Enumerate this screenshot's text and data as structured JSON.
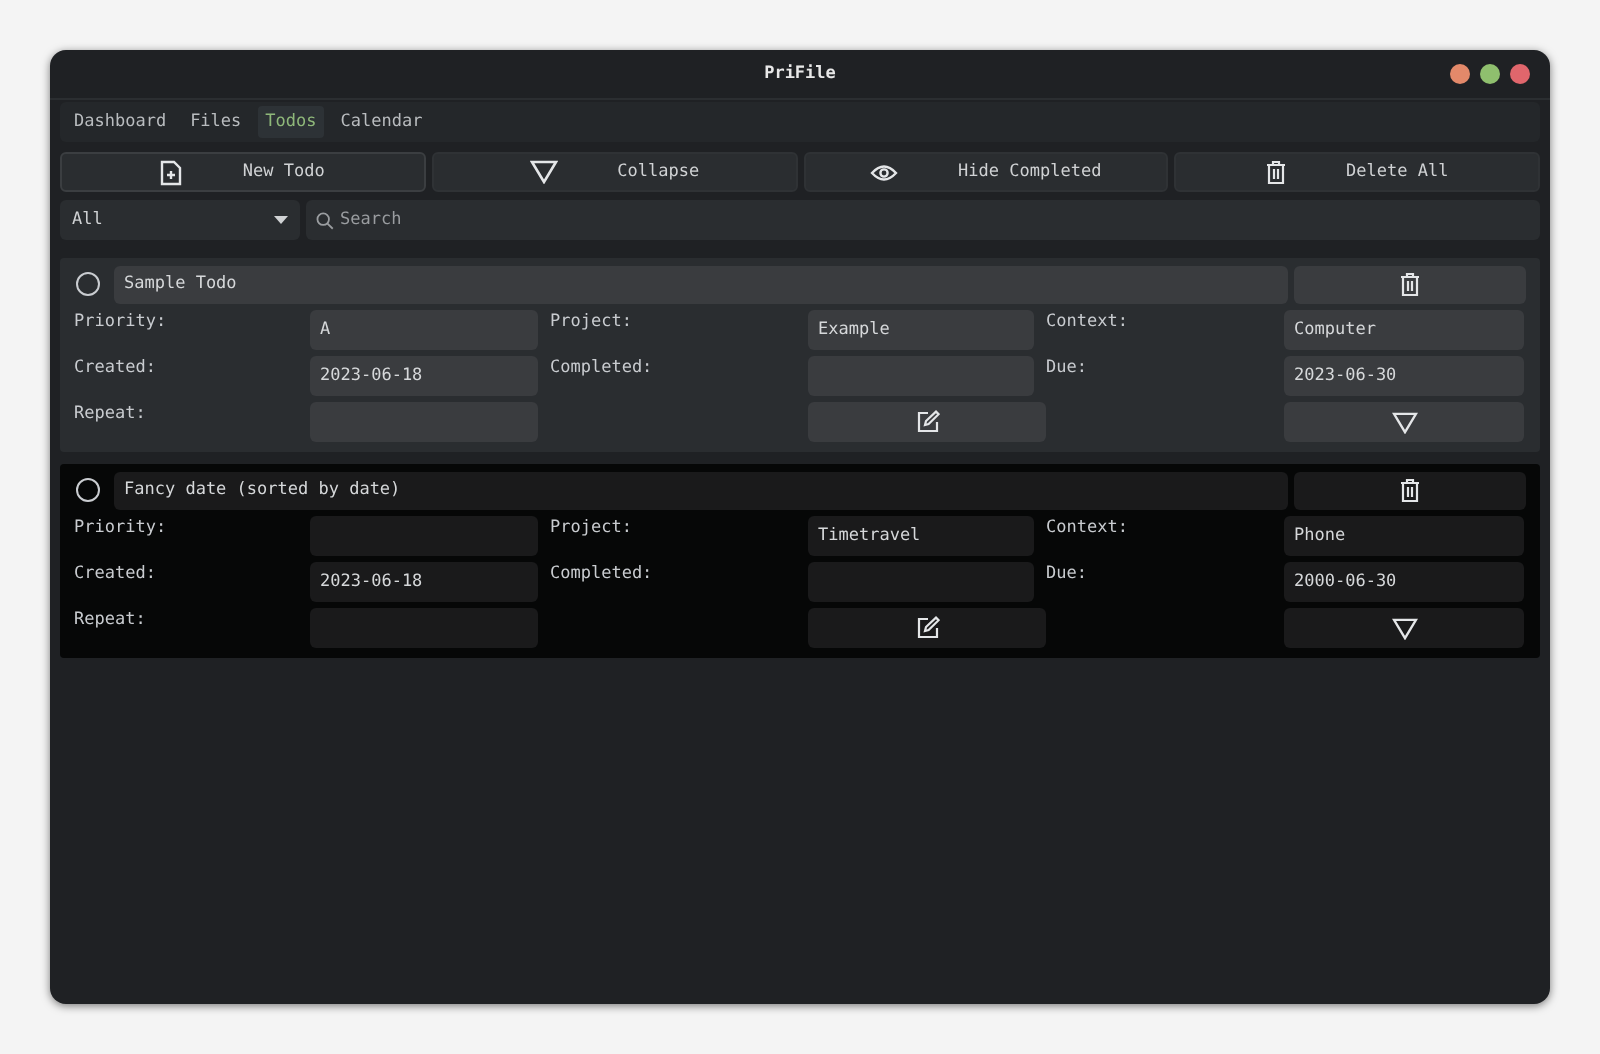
{
  "window": {
    "title": "PriFile"
  },
  "tabs": [
    {
      "label": "Dashboard",
      "selected": false
    },
    {
      "label": "Files",
      "selected": false
    },
    {
      "label": "Todos",
      "selected": true
    },
    {
      "label": "Calendar",
      "selected": false
    }
  ],
  "toolbar": [
    {
      "label": "New Todo",
      "kind": "new"
    },
    {
      "label": "Collapse",
      "kind": "collapse"
    },
    {
      "label": "Hide Completed",
      "kind": "hide"
    },
    {
      "label": "Delete All",
      "kind": "delete"
    }
  ],
  "filter": {
    "value": "All"
  },
  "search": {
    "placeholder": "Search"
  },
  "todos": [
    {
      "title": "Sample Todo",
      "checked": false,
      "selected": false,
      "rows": [
        [
          {
            "kind": "label",
            "text": "Priority:"
          },
          {
            "kind": "field",
            "value": "A"
          },
          {
            "kind": "label",
            "text": "Project:"
          },
          {
            "kind": "field",
            "value": "Example"
          },
          {
            "kind": "label",
            "text": "Context:"
          },
          {
            "kind": "field",
            "value": "Computer"
          }
        ],
        [
          {
            "kind": "label",
            "text": "Created:"
          },
          {
            "kind": "field",
            "value": "2023-06-18"
          },
          {
            "kind": "label",
            "text": "Completed:"
          },
          {
            "kind": "field"
          },
          {
            "kind": "label",
            "text": "Due:"
          },
          {
            "kind": "field",
            "value": "2023-06-30"
          }
        ],
        [
          {
            "kind": "label",
            "text": "Repeat:"
          },
          {
            "kind": "field"
          },
          {
            "kind": "spacer"
          },
          {
            "kind": "edit"
          },
          {
            "kind": "spacer"
          },
          {
            "kind": "expand"
          }
        ]
      ]
    },
    {
      "title": "Fancy date (sorted by date)",
      "checked": false,
      "selected": true,
      "rows": [
        [
          {
            "kind": "label",
            "text": "Priority:"
          },
          {
            "kind": "field"
          },
          {
            "kind": "label",
            "text": "Project:"
          },
          {
            "kind": "field",
            "value": "Timetravel"
          },
          {
            "kind": "label",
            "text": "Context:"
          },
          {
            "kind": "field",
            "value": "Phone"
          }
        ],
        [
          {
            "kind": "label",
            "text": "Created:"
          },
          {
            "kind": "field",
            "value": "2023-06-18"
          },
          {
            "kind": "label",
            "text": "Completed:"
          },
          {
            "kind": "field"
          },
          {
            "kind": "label",
            "text": "Due:"
          },
          {
            "kind": "field",
            "value": "2000-06-30"
          }
        ],
        [
          {
            "kind": "label",
            "text": "Repeat:"
          },
          {
            "kind": "field"
          },
          {
            "kind": "spacer"
          },
          {
            "kind": "edit"
          },
          {
            "kind": "spacer"
          },
          {
            "kind": "expand"
          }
        ]
      ]
    }
  ]
}
